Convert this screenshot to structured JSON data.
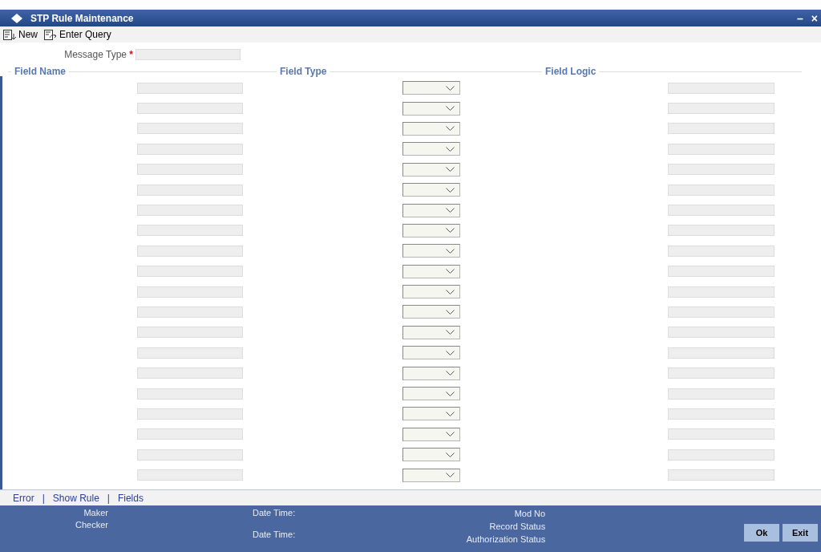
{
  "window": {
    "title": "STP Rule Maintenance",
    "controls": [
      "–",
      "×"
    ]
  },
  "toolbar": [
    {
      "label": "New",
      "kind": "new"
    },
    {
      "label": "Enter Query",
      "kind": "query"
    }
  ],
  "message_type": {
    "label": "Message Type",
    "required_mark": "*"
  },
  "sections": [
    "Field Name",
    "Field Type",
    "Field Logic"
  ],
  "rows": [
    {
      "kind": "empty"
    },
    {
      "kind": "empty"
    },
    {
      "kind": "empty"
    },
    {
      "kind": "empty"
    },
    {
      "kind": "empty"
    },
    {
      "kind": "empty"
    },
    {
      "kind": "empty"
    },
    {
      "kind": "empty"
    },
    {
      "kind": "empty"
    },
    {
      "kind": "empty"
    },
    {
      "kind": "empty"
    },
    {
      "kind": "empty"
    },
    {
      "kind": "empty"
    },
    {
      "kind": "empty"
    },
    {
      "kind": "empty"
    },
    {
      "kind": "empty"
    },
    {
      "kind": "empty"
    },
    {
      "kind": "empty"
    },
    {
      "kind": "empty"
    },
    {
      "kind": "empty"
    }
  ],
  "links": [
    "Error",
    "Show Rule",
    "Fields"
  ],
  "link_separator": "|",
  "audit": {
    "col1": [
      "Maker",
      "Checker"
    ],
    "col2": [
      "Date Time:",
      "Date Time:"
    ],
    "col3": [
      "Mod No",
      "Record Status",
      "Authorization Status"
    ]
  },
  "buttons": [
    "Ok",
    "Exit"
  ]
}
